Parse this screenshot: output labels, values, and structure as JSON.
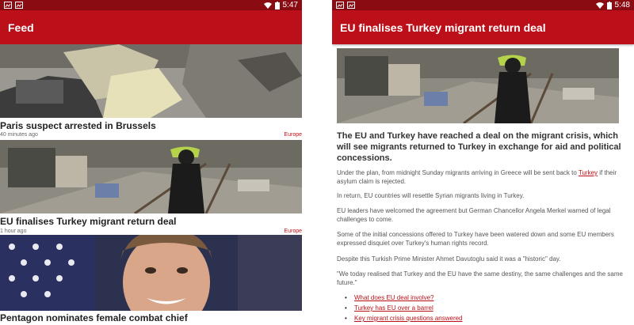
{
  "left_screen": {
    "status": {
      "time": "5:47"
    },
    "appbar": {
      "title": "Feed"
    },
    "stories": [
      {
        "headline": "Paris suspect arrested in Brussels",
        "time": "40 minutes ago",
        "tag": "Europe"
      },
      {
        "headline": "EU finalises Turkey migrant return deal",
        "time": "1 hour ago",
        "tag": "Europe"
      },
      {
        "headline": "Pentagon nominates female combat chief",
        "time": "",
        "tag": ""
      }
    ]
  },
  "right_screen": {
    "status": {
      "time": "5:48"
    },
    "appbar": {
      "title": "EU finalises Turkey migrant return deal"
    },
    "lead": "The EU and Turkey have reached a deal on the migrant crisis, which will see migrants returned to Turkey in exchange for aid and political concessions.",
    "p1_before": "Under the plan, from midnight Sunday migrants arriving in Greece will be sent back to ",
    "p1_link": "Turkey",
    "p1_after": " if their asylum claim is rejected.",
    "p2": "In return, EU countries will resettle Syrian migrants living in Turkey.",
    "p3": "EU leaders have welcomed the agreement but German Chancellor Angela Merkel warned of legal challenges to come.",
    "p4": "Some of the initial concessions offered to Turkey have been watered down and some EU members expressed disquiet over Turkey's human rights record.",
    "p5": "Despite this Turkish Prime Minister Ahmet Davutoglu said it was a \"historic\" day.",
    "p6": "\"We today realised that Turkey and the EU have the same destiny, the same challenges and the same future.\"",
    "links": [
      "What does EU deal involve?",
      "Turkey has EU over a barrel",
      "Key migrant crisis questions answered"
    ]
  },
  "colors": {
    "brand": "#bb1019",
    "statusbar": "#8a0b12"
  }
}
